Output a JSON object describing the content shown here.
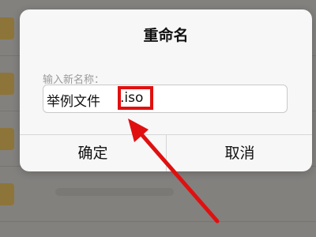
{
  "dialog": {
    "title": "重命名",
    "field_label": "输入新名称：",
    "input_name": "举例文件",
    "input_extension": ".iso",
    "confirm_label": "确定",
    "cancel_label": "取消"
  },
  "annotation": {
    "color": "#e01010",
    "icon": "arrow-icon"
  }
}
